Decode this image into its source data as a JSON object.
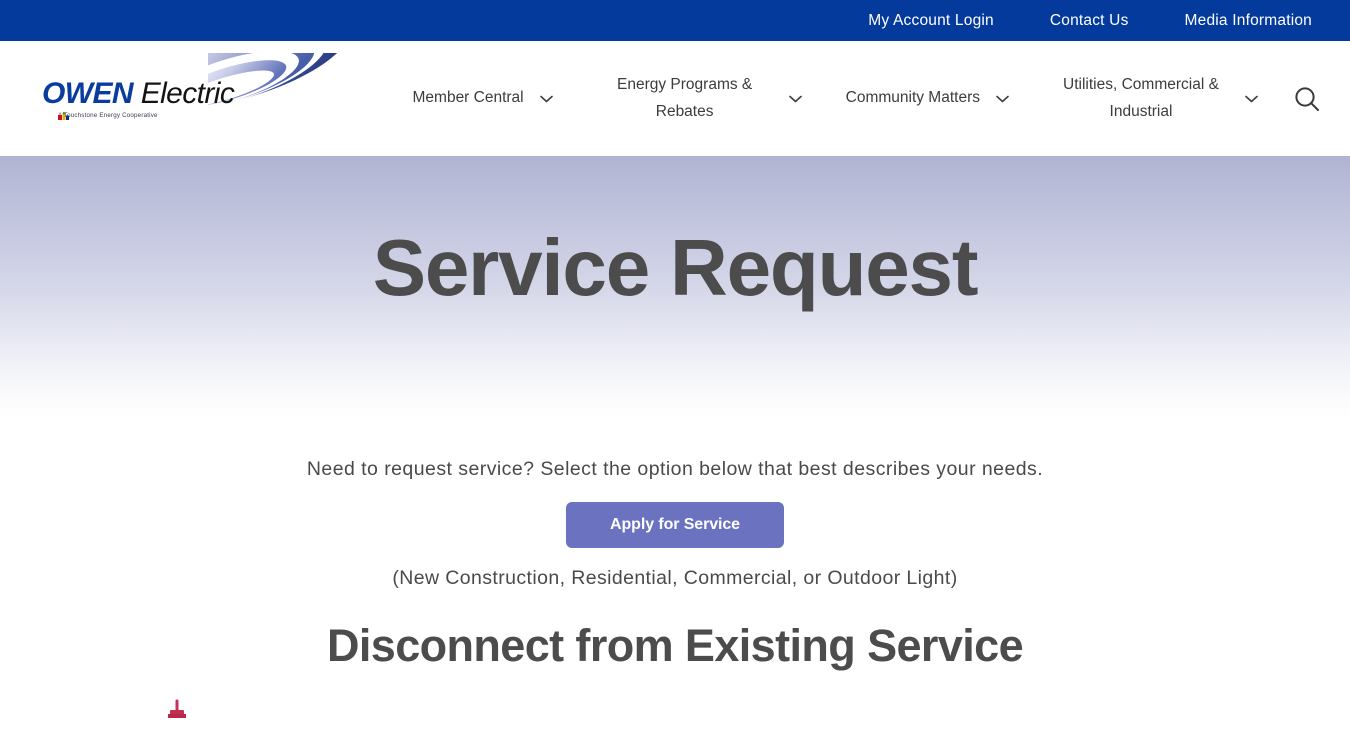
{
  "topbar": {
    "links": [
      {
        "label": "My Account Login"
      },
      {
        "label": "Contact Us"
      },
      {
        "label": "Media Information"
      }
    ],
    "background_color": "#043a9b"
  },
  "header": {
    "logo": {
      "brand_primary": "OWEN",
      "brand_secondary": "Electric",
      "tagline": "A Touchstone Energy Cooperative",
      "primary_color": "#0a3b9e",
      "secondary_color": "#141414"
    },
    "nav": [
      {
        "label": "Member Central",
        "has_dropdown": true
      },
      {
        "label": "Energy Programs & Rebates",
        "has_dropdown": true
      },
      {
        "label": "Community Matters",
        "has_dropdown": true
      },
      {
        "label": "Utilities, Commercial & Industrial",
        "has_dropdown": true
      }
    ],
    "search": {
      "icon": "search-icon"
    }
  },
  "hero": {
    "title": "Service Request",
    "title_color": "#4c4c4c",
    "gradient_top": "#b0b4d2",
    "gradient_bottom": "#ffffff"
  },
  "main": {
    "lead": "Need to request service? Select the option below that best describes your needs.",
    "apply_button": {
      "label": "Apply for Service",
      "color": "#6b73c0"
    },
    "apply_note": "(New Construction, Residential, Commercial, or Outdoor Light)",
    "section_heading": "Disconnect from Existing Service"
  }
}
